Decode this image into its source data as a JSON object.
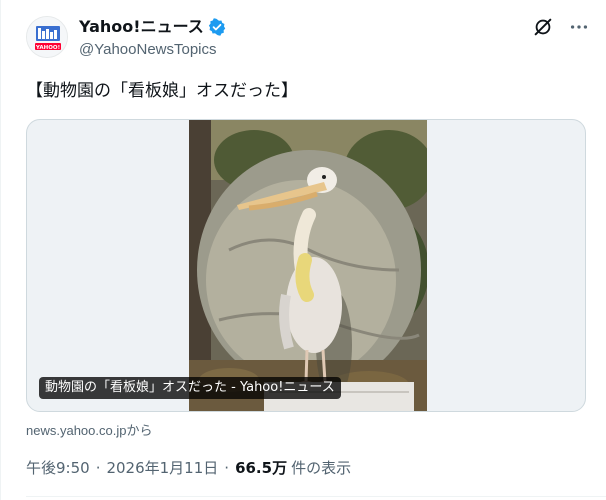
{
  "author": {
    "display_name": "Yahoo!ニュース",
    "handle": "@YahooNewsTopics",
    "verified": true,
    "avatar_label": "YAHOO!"
  },
  "post": {
    "text": "【動物園の「看板娘」オスだった】"
  },
  "card": {
    "caption": "動物園の「看板娘」オスだった - Yahoo!ニュース",
    "source": "news.yahoo.co.jpから"
  },
  "meta": {
    "time": "午後9:50",
    "dot1": "·",
    "date": "2026年1月11日",
    "dot2": "·",
    "views": "66.5万",
    "views_label": "件の表示"
  },
  "icons": {
    "verified": "verified-badge-icon",
    "grok": "grok-icon",
    "more": "more-icon"
  },
  "colors": {
    "text": "#0f1419",
    "secondary": "#536471",
    "verified_blue": "#1d9bf0",
    "border": "#cfd9de",
    "card_bg": "#eef2f5"
  }
}
